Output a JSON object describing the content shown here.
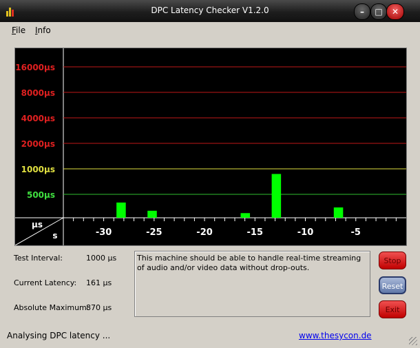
{
  "window": {
    "title": "DPC Latency Checker V1.2.0"
  },
  "menu": {
    "file": "File",
    "file_accel": "F",
    "file_rest": "ile",
    "info": "Info",
    "info_accel": "I",
    "info_rest": "nfo"
  },
  "chart_data": {
    "type": "bar",
    "y_ticks": [
      {
        "label": "16000µs",
        "value": 16000,
        "color": "#e02020"
      },
      {
        "label": "8000µs",
        "value": 8000,
        "color": "#e02020"
      },
      {
        "label": "4000µs",
        "value": 4000,
        "color": "#e02020"
      },
      {
        "label": "2000µs",
        "value": 2000,
        "color": "#e02020"
      },
      {
        "label": "1000µs",
        "value": 1000,
        "color": "#e0e040"
      },
      {
        "label": "500µs",
        "value": 500,
        "color": "#40e040"
      }
    ],
    "x_ticks": [
      "-30",
      "-25",
      "-20",
      "-15",
      "-10",
      "-5"
    ],
    "x_tick_values": [
      -30,
      -25,
      -20,
      -15,
      -10,
      -5
    ],
    "corner_y_unit": "µs",
    "corner_x_unit": "s",
    "bar_color": "#00ff00",
    "x_range": [
      -34,
      0
    ],
    "values": [
      170,
      190,
      180,
      180,
      170,
      400,
      170,
      190,
      320,
      180,
      180,
      180,
      170,
      190,
      170,
      190,
      170,
      300,
      170,
      180,
      870,
      170,
      250,
      180,
      160,
      200,
      350,
      160,
      160,
      180,
      170,
      190,
      161
    ]
  },
  "info": {
    "test_interval_label": "Test Interval:",
    "test_interval_value": "1000 µs",
    "current_latency_label": "Current Latency:",
    "current_latency_value": "161 µs",
    "absolute_max_label": "Absolute Maximum:",
    "absolute_max_value": "870 µs"
  },
  "message": "This machine should be able to handle real-time streaming of audio and/or video data without drop-outs.",
  "buttons": {
    "stop": "Stop",
    "reset": "Reset",
    "exit": "Exit"
  },
  "status": {
    "text": "Analysing DPC latency ...",
    "link": "www.thesycon.de"
  },
  "colors": {
    "grid_red": "#c01818",
    "grid_yellow": "#e0e040",
    "grid_green": "#30c030",
    "bars": "#00ff00"
  }
}
